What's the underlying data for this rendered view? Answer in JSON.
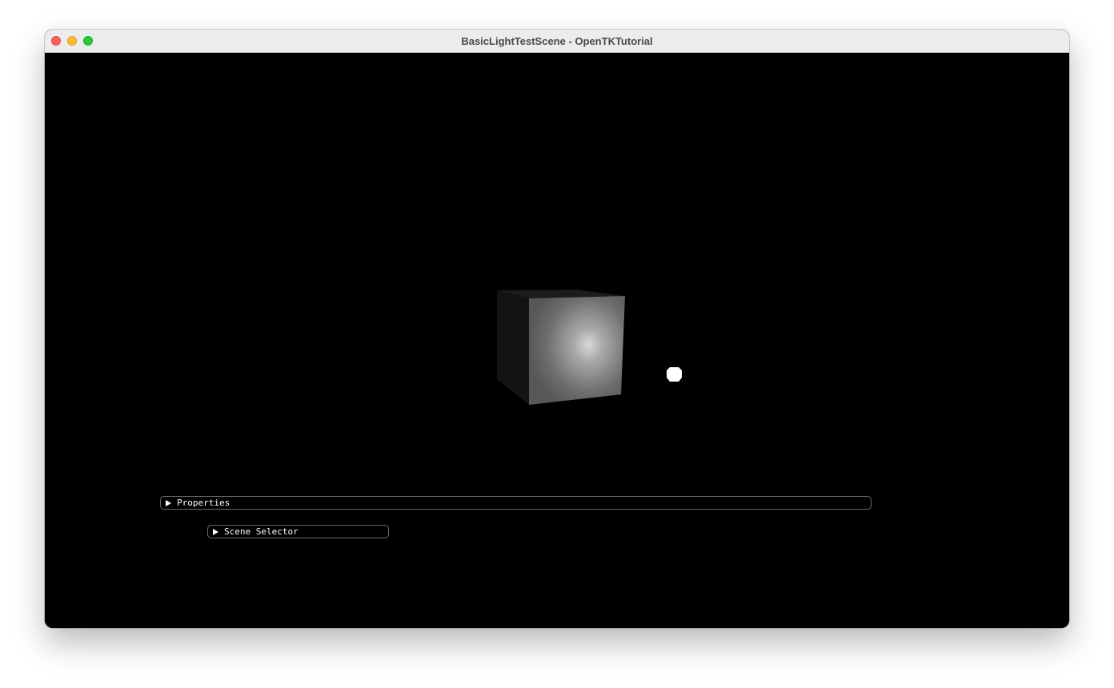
{
  "window": {
    "title": "BasicLightTestScene - OpenTKTutorial",
    "controls": [
      "close",
      "minimize",
      "maximize"
    ]
  },
  "scene": {
    "background_color": "#000000",
    "objects": [
      {
        "kind": "cube",
        "description": "lit gray cube"
      },
      {
        "kind": "light-source",
        "color": "#ffffff"
      }
    ]
  },
  "panels": {
    "properties": {
      "label": "Properties",
      "expanded": false
    },
    "scene_selector": {
      "label": "Scene Selector",
      "expanded": false
    }
  },
  "colors": {
    "titlebar": "#ececec",
    "title_text": "#4a4a4a",
    "close": "#ff5f57",
    "minimize": "#febc2e",
    "maximize": "#28c840",
    "panel_border": "#6a6a6a",
    "panel_text": "#ffffff"
  }
}
